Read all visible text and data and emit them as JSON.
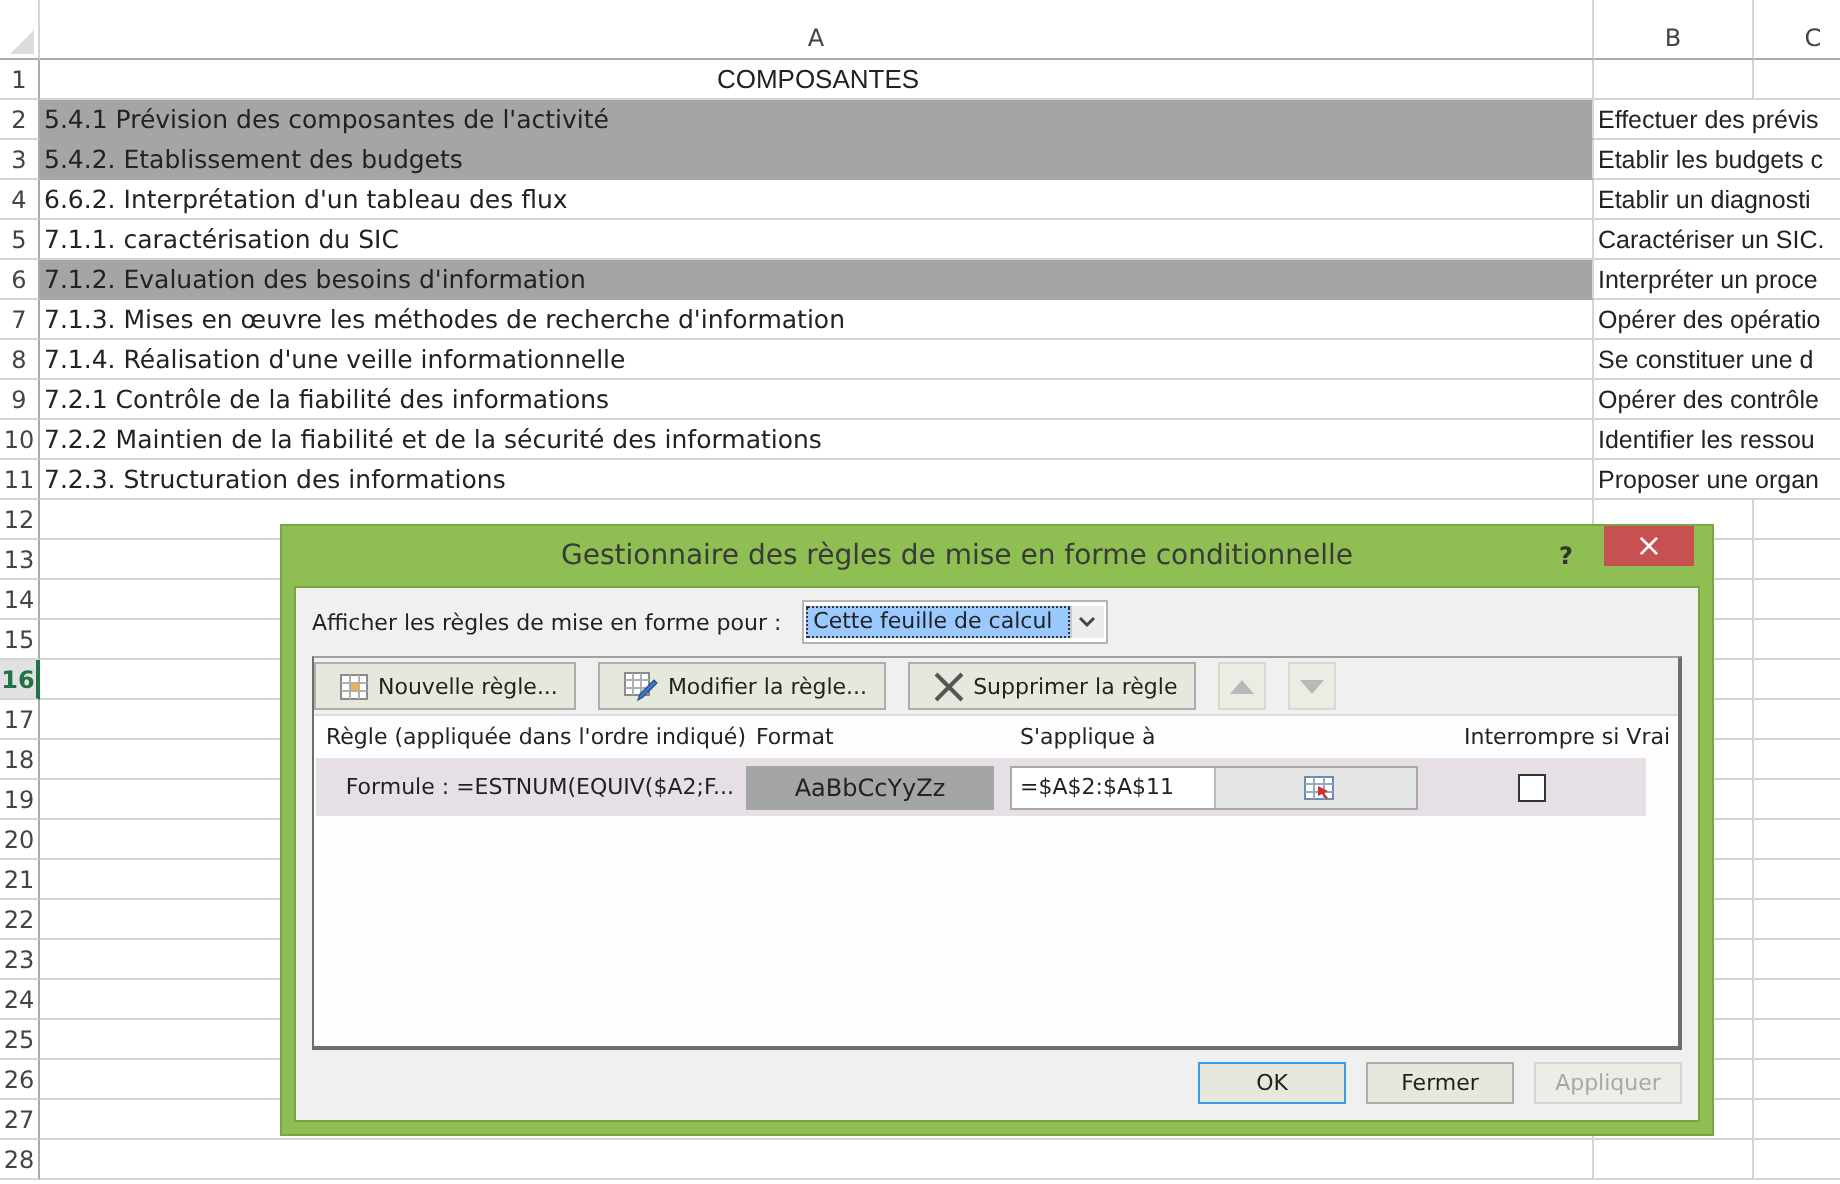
{
  "sheet": {
    "columns": [
      {
        "label": "A"
      },
      {
        "label": "B"
      },
      {
        "label": "C"
      }
    ],
    "rows": [
      {
        "number": "1",
        "selected": false,
        "cells": [
          {
            "text": "COMPOSANTES",
            "kind": "title",
            "shaded": false
          }
        ]
      },
      {
        "number": "2",
        "selected": false,
        "cells": [
          {
            "text": "5.4.1 Prévision des composantes de l'activité",
            "kind": "text",
            "shaded": true
          },
          {
            "text": "Effectuer des prévis",
            "kind": "text",
            "shaded": false
          }
        ]
      },
      {
        "number": "3",
        "selected": false,
        "cells": [
          {
            "text": "5.4.2. Etablissement des budgets",
            "kind": "text",
            "shaded": true
          },
          {
            "text": "Etablir les budgets c",
            "kind": "text",
            "shaded": false
          }
        ]
      },
      {
        "number": "4",
        "selected": false,
        "cells": [
          {
            "text": "6.6.2. Interprétation d'un tableau des flux",
            "kind": "text",
            "shaded": false
          },
          {
            "text": "Etablir un diagnosti",
            "kind": "text",
            "shaded": false
          }
        ]
      },
      {
        "number": "5",
        "selected": false,
        "cells": [
          {
            "text": "7.1.1. caractérisation du SIC",
            "kind": "text",
            "shaded": false
          },
          {
            "text": "Caractériser un SIC.",
            "kind": "text",
            "shaded": false
          }
        ]
      },
      {
        "number": "6",
        "selected": false,
        "cells": [
          {
            "text": "7.1.2. Evaluation des besoins d'information",
            "kind": "text",
            "shaded": true
          },
          {
            "text": "Interpréter un proce",
            "kind": "text",
            "shaded": false
          }
        ]
      },
      {
        "number": "7",
        "selected": false,
        "cells": [
          {
            "text": "7.1.3. Mises en œuvre les méthodes de recherche d'information",
            "kind": "text",
            "shaded": false
          },
          {
            "text": "Opérer des opératio",
            "kind": "text",
            "shaded": false
          }
        ]
      },
      {
        "number": "8",
        "selected": false,
        "cells": [
          {
            "text": "7.1.4. Réalisation d'une veille informationnelle",
            "kind": "text",
            "shaded": false
          },
          {
            "text": "Se constituer une d",
            "kind": "text",
            "shaded": false
          }
        ]
      },
      {
        "number": "9",
        "selected": false,
        "cells": [
          {
            "text": "7.2.1 Contrôle de la fiabilité des informations",
            "kind": "text",
            "shaded": false
          },
          {
            "text": "Opérer des contrôle",
            "kind": "text",
            "shaded": false
          }
        ]
      },
      {
        "number": "10",
        "selected": false,
        "cells": [
          {
            "text": "7.2.2 Maintien de la fiabilité et de la sécurité des informations",
            "kind": "text",
            "shaded": false
          },
          {
            "text": "Identifier les ressou",
            "kind": "text",
            "shaded": false
          }
        ]
      },
      {
        "number": "11",
        "selected": false,
        "cells": [
          {
            "text": "7.2.3. Structuration des informations",
            "kind": "text",
            "shaded": false
          },
          {
            "text": "Proposer une organ",
            "kind": "text",
            "shaded": false
          }
        ]
      },
      {
        "number": "12",
        "selected": false
      },
      {
        "number": "13",
        "selected": false
      },
      {
        "number": "14",
        "selected": false
      },
      {
        "number": "15",
        "selected": false
      },
      {
        "number": "16",
        "selected": true
      },
      {
        "number": "17",
        "selected": false
      },
      {
        "number": "18",
        "selected": false
      },
      {
        "number": "19",
        "selected": false
      },
      {
        "number": "20",
        "selected": false
      },
      {
        "number": "21",
        "selected": false
      },
      {
        "number": "22",
        "selected": false
      },
      {
        "number": "23",
        "selected": false
      },
      {
        "number": "24",
        "selected": false
      },
      {
        "number": "25",
        "selected": false
      },
      {
        "number": "26",
        "selected": false
      },
      {
        "number": "27",
        "selected": false
      },
      {
        "number": "28",
        "selected": false
      }
    ]
  },
  "dialog": {
    "title": "Gestionnaire des règles de mise en forme conditionnelle",
    "help": "?",
    "close": "×",
    "show_for": {
      "label": "Afficher les règles de mise en forme pour :",
      "value": "Cette feuille de calcul"
    },
    "toolbar": [
      {
        "kind": "new",
        "label": "Nouvelle règle...",
        "disabled": false
      },
      {
        "kind": "edit",
        "label": "Modifier la règle...",
        "disabled": false
      },
      {
        "kind": "delete",
        "label": "Supprimer la règle",
        "disabled": false
      },
      {
        "kind": "up",
        "disabled": true
      },
      {
        "kind": "down",
        "disabled": true
      }
    ],
    "columns": [
      "Règle (appliquée dans l'ordre indiqué)",
      "Format",
      "S'applique à",
      "Interrompre si Vrai"
    ],
    "rules": [
      {
        "rule": "Formule : =ESTNUM(EQUIV($A2;F...",
        "preview": "AaBbCcYyZz",
        "applies_to": "=$A$2:$A$11",
        "stop_if_true": false,
        "selected": true
      }
    ],
    "buttons": [
      {
        "label": "OK",
        "default": true,
        "disabled": false
      },
      {
        "label": "Fermer",
        "default": false,
        "disabled": false
      },
      {
        "label": "Appliquer",
        "default": false,
        "disabled": true
      }
    ]
  }
}
